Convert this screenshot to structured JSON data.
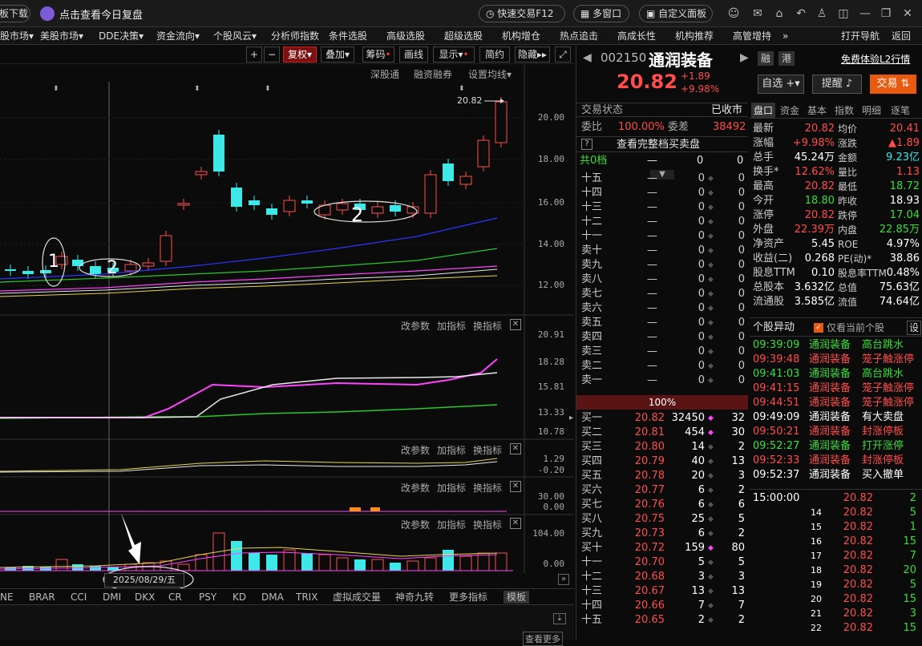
{
  "titlebar": {
    "left_button": "板下载",
    "review": "点击查看今日复盘",
    "quick_trade": "快速交易F12",
    "multi_window": "多窗口",
    "custom_panel": "自定义面板"
  },
  "menu": [
    "股市场▾",
    "美股市场▾",
    "DDE决策▾",
    "资金流向▾",
    "个股风云▾",
    "分析师指数",
    "条件选股",
    "高级选股",
    "超级选股",
    "机构增仓",
    "热点追击",
    "高成长性",
    "机构推荐",
    "高管增持",
    "»",
    "打开导航",
    "返回"
  ],
  "toolbar": {
    "plus": "+",
    "minus": "−",
    "fuquan": "复权",
    "diejia": "叠加",
    "chouma": "筹码",
    "huaxian": "画线",
    "xianshi": "显示",
    "jianyue": "简约",
    "yincang": "隐藏"
  },
  "chart": {
    "links": [
      "深股通",
      "融资融券",
      "设置均线"
    ],
    "price_label": "20.82",
    "y_main": [
      "20.00",
      "18.00",
      "16.00",
      "14.00",
      "12.00"
    ],
    "y_ind1": [
      "20.91",
      "18.28",
      "15.81",
      "13.33",
      "10.78"
    ],
    "y_ind2": [
      "1.29",
      "-0.20"
    ],
    "y_ind3": [
      "30.00",
      "0.00"
    ],
    "y_ind4": [
      "104.00",
      "0.00"
    ],
    "sub_actions": [
      "改参数",
      "加指标",
      "换指标"
    ],
    "date_label": "2025/08/29/五",
    "annot1": "1",
    "annot2a": "2",
    "annot2b": "2"
  },
  "indicators": [
    "NE",
    "BRAR",
    "CCI",
    "DMI",
    "DKX",
    "CR",
    "PSY",
    "KD",
    "DMA",
    "TRIX",
    "虚拟成交量",
    "神奇九转",
    "更多指标",
    "模板"
  ],
  "bottom": {
    "more": "查看更多"
  },
  "stock": {
    "code": "002150",
    "name": "通润装备",
    "rong": "融",
    "gang": "港",
    "l2": "免费体验L2行情",
    "price": "20.82",
    "change": "+1.89",
    "pct": "+9.98%",
    "zixuan": "自选",
    "tixing": "提醒",
    "jiaoyi": "交易"
  },
  "status": {
    "label": "交易状态",
    "value": "已收市"
  },
  "weibi": {
    "label": "委比",
    "value": "100.00%",
    "label2": "委差",
    "value2": "38492"
  },
  "full_book": "查看完整档买卖盘",
  "gong": {
    "label": "共0档",
    "a": "—",
    "b": "0",
    "c": "0"
  },
  "sells": [
    [
      "十五",
      "—",
      "0",
      "0"
    ],
    [
      "十四",
      "—",
      "0",
      "0"
    ],
    [
      "十三",
      "—",
      "0",
      "0"
    ],
    [
      "十二",
      "—",
      "0",
      "0"
    ],
    [
      "十一",
      "—",
      "0",
      "0"
    ],
    [
      "卖十",
      "—",
      "0",
      "0"
    ],
    [
      "卖九",
      "—",
      "0",
      "0"
    ],
    [
      "卖八",
      "—",
      "0",
      "0"
    ],
    [
      "卖七",
      "—",
      "0",
      "0"
    ],
    [
      "卖六",
      "—",
      "0",
      "0"
    ],
    [
      "卖五",
      "—",
      "0",
      "0"
    ],
    [
      "卖四",
      "—",
      "0",
      "0"
    ],
    [
      "卖三",
      "—",
      "0",
      "0"
    ],
    [
      "卖二",
      "—",
      "0",
      "0"
    ],
    [
      "卖一",
      "—",
      "0",
      "0"
    ]
  ],
  "mid_pct": "100%",
  "buys": [
    [
      "买一",
      "20.82",
      "32450",
      "32"
    ],
    [
      "买二",
      "20.81",
      "454",
      "30"
    ],
    [
      "买三",
      "20.80",
      "14",
      "2"
    ],
    [
      "买四",
      "20.79",
      "40",
      "13"
    ],
    [
      "买五",
      "20.78",
      "20",
      "3"
    ],
    [
      "买六",
      "20.77",
      "6",
      "2"
    ],
    [
      "买七",
      "20.76",
      "6",
      "6"
    ],
    [
      "买八",
      "20.75",
      "25",
      "5"
    ],
    [
      "买九",
      "20.73",
      "6",
      "2"
    ],
    [
      "买十",
      "20.72",
      "159",
      "80"
    ],
    [
      "十一",
      "20.70",
      "5",
      "5"
    ],
    [
      "十二",
      "20.68",
      "3",
      "3"
    ],
    [
      "十三",
      "20.67",
      "13",
      "13"
    ],
    [
      "十四",
      "20.66",
      "7",
      "7"
    ],
    [
      "十五",
      "20.65",
      "2",
      "2"
    ]
  ],
  "tabs": [
    "盘口",
    "资金",
    "基本",
    "指数",
    "明细",
    "逐笔"
  ],
  "quote": [
    [
      "最新",
      "20.82",
      "均价",
      "20.41"
    ],
    [
      "涨幅",
      "+9.98%",
      "涨跌",
      "▲1.89"
    ],
    [
      "总手",
      "45.24万",
      "金额",
      "9.23亿"
    ],
    [
      "换手*",
      "12.62%",
      "量比",
      "1.13"
    ],
    [
      "最高",
      "20.82",
      "最低",
      "18.72"
    ],
    [
      "今开",
      "18.80",
      "昨收",
      "18.93"
    ],
    [
      "涨停",
      "20.82",
      "跌停",
      "17.04"
    ],
    [
      "外盘",
      "22.39万",
      "内盘",
      "22.85万"
    ],
    [
      "净资产",
      "5.45",
      "ROE",
      "4.97%"
    ],
    [
      "收益(二)",
      "0.268",
      "PE(动)*",
      "38.86"
    ],
    [
      "股息TTM",
      "0.10",
      "股息率TTM",
      "0.48%"
    ],
    [
      "总股本",
      "3.632亿",
      "总值",
      "75.63亿"
    ],
    [
      "流通股",
      "3.585亿",
      "流值",
      "74.64亿"
    ]
  ],
  "anomaly": {
    "title": "个股异动",
    "checkbox": "仅看当前个股",
    "set": "设",
    "rows": [
      [
        "09:39:09",
        "通润装备",
        "高台跳水",
        "g"
      ],
      [
        "09:39:48",
        "通润装备",
        "笼子触涨停",
        "r"
      ],
      [
        "09:41:03",
        "通润装备",
        "高台跳水",
        "g"
      ],
      [
        "09:41:15",
        "通润装备",
        "笼子触涨停",
        "r"
      ],
      [
        "09:44:51",
        "通润装备",
        "笼子触涨停",
        "r"
      ],
      [
        "09:49:09",
        "通润装备",
        "有大卖盘",
        "w"
      ],
      [
        "09:50:21",
        "通润装备",
        "封涨停板",
        "r"
      ],
      [
        "09:52:27",
        "通润装备",
        "打开涨停",
        "g"
      ],
      [
        "09:52:33",
        "通润装备",
        "封涨停板",
        "r"
      ],
      [
        "09:52:37",
        "通润装备",
        "买入撤单",
        "w"
      ]
    ]
  },
  "ticks": [
    [
      "15:00:00",
      "20.82",
      "2"
    ],
    [
      "14",
      "20.82",
      "5"
    ],
    [
      "15",
      "20.82",
      "1"
    ],
    [
      "16",
      "20.82",
      "15"
    ],
    [
      "17",
      "20.82",
      "7"
    ],
    [
      "18",
      "20.82",
      "20"
    ],
    [
      "19",
      "20.82",
      "5"
    ],
    [
      "20",
      "20.82",
      "15"
    ],
    [
      "21",
      "20.82",
      "3"
    ],
    [
      "22",
      "20.82",
      "15"
    ]
  ]
}
